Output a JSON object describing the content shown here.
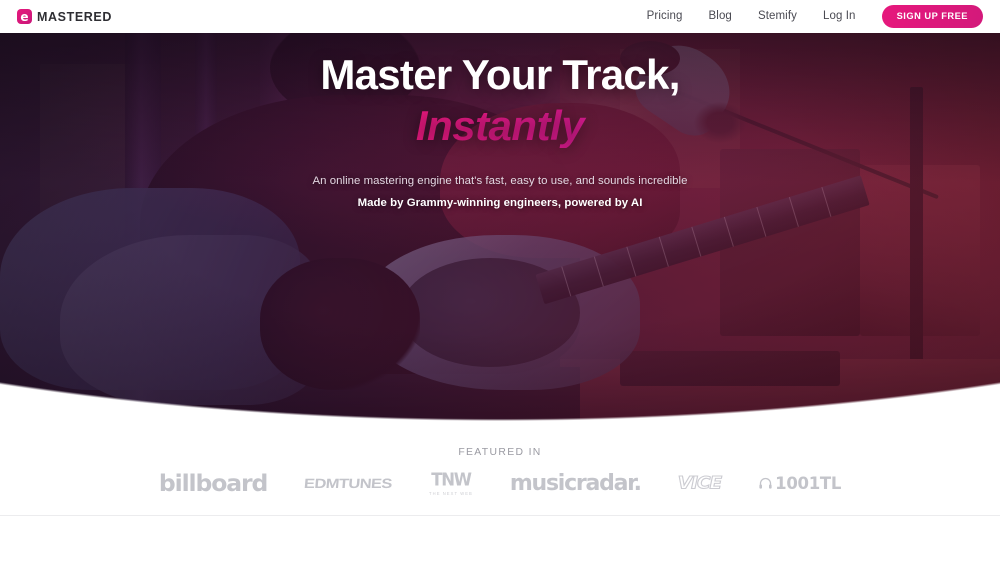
{
  "brand": {
    "mark_glyph": "e",
    "mark_icon": "emastered-logo-icon",
    "name": "MASTERED",
    "accent_color": "#e6187c"
  },
  "nav": {
    "links": [
      {
        "label": "Pricing"
      },
      {
        "label": "Blog"
      },
      {
        "label": "Stemify"
      },
      {
        "label": "Log In"
      }
    ],
    "cta_label": "SIGN UP FREE"
  },
  "hero": {
    "headline_line1": "Master Your Track,",
    "headline_line2": "Instantly",
    "subtitle_1": "An online mastering engine that's fast, easy to use, and sounds incredible",
    "subtitle_2": "Made by Grammy-winning engineers, powered by AI",
    "accent_gradient_from": "#ff1f86",
    "accent_gradient_to": "#b01ea8",
    "image_alt": "musician playing bass guitar in a recording studio with microphone"
  },
  "featured": {
    "label": "FEATURED IN",
    "logos": [
      {
        "name": "billboard",
        "text": "billboard"
      },
      {
        "name": "edmtunes",
        "text": "EDMTUNES"
      },
      {
        "name": "tnw",
        "text": "TNW",
        "sub": "THE NEXT WEB"
      },
      {
        "name": "musicradar",
        "text": "musicradar."
      },
      {
        "name": "vice",
        "text": "VICE"
      },
      {
        "name": "1001tracklists",
        "text": "1001TL",
        "icon": "headphones-icon"
      }
    ]
  }
}
